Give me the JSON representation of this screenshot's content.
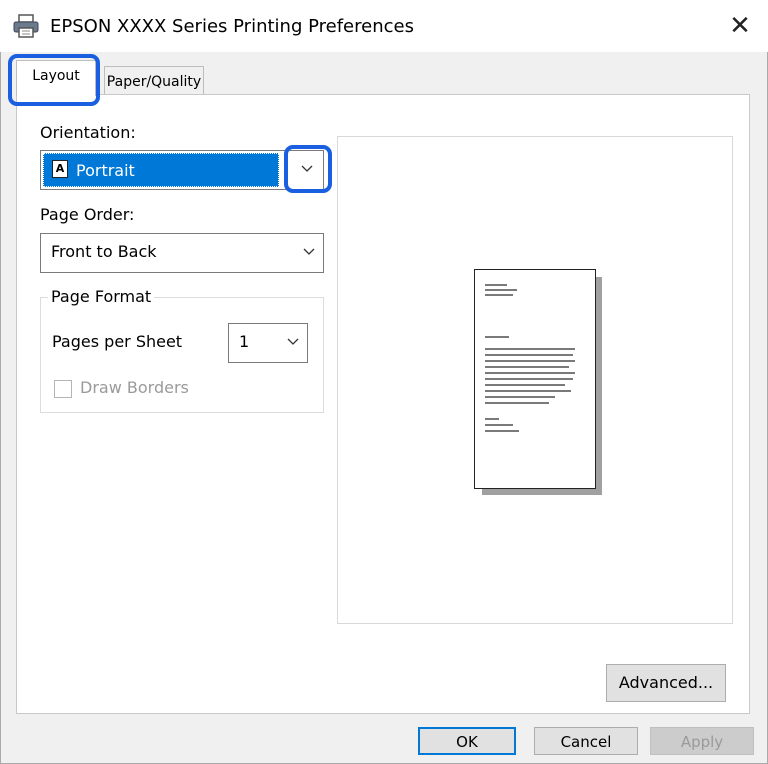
{
  "window": {
    "title": "EPSON XXXX Series Printing Preferences",
    "close_glyph": "✕"
  },
  "tabs": [
    {
      "label": "Layout",
      "active": true
    },
    {
      "label": "Paper/Quality",
      "active": false
    }
  ],
  "orientation": {
    "label": "Orientation:",
    "value": "Portrait",
    "icon": "portrait-page-icon"
  },
  "page_order": {
    "label": "Page Order:",
    "value": "Front to Back"
  },
  "page_format": {
    "group_label": "Page Format",
    "pages_per_sheet_label": "Pages per Sheet",
    "pages_per_sheet_value": "1",
    "draw_borders_label": "Draw Borders"
  },
  "buttons": {
    "advanced": "Advanced...",
    "ok": "OK",
    "cancel": "Cancel",
    "apply": "Apply"
  },
  "colors": {
    "highlight": "#1a5fe0",
    "selection": "#0078d7"
  }
}
